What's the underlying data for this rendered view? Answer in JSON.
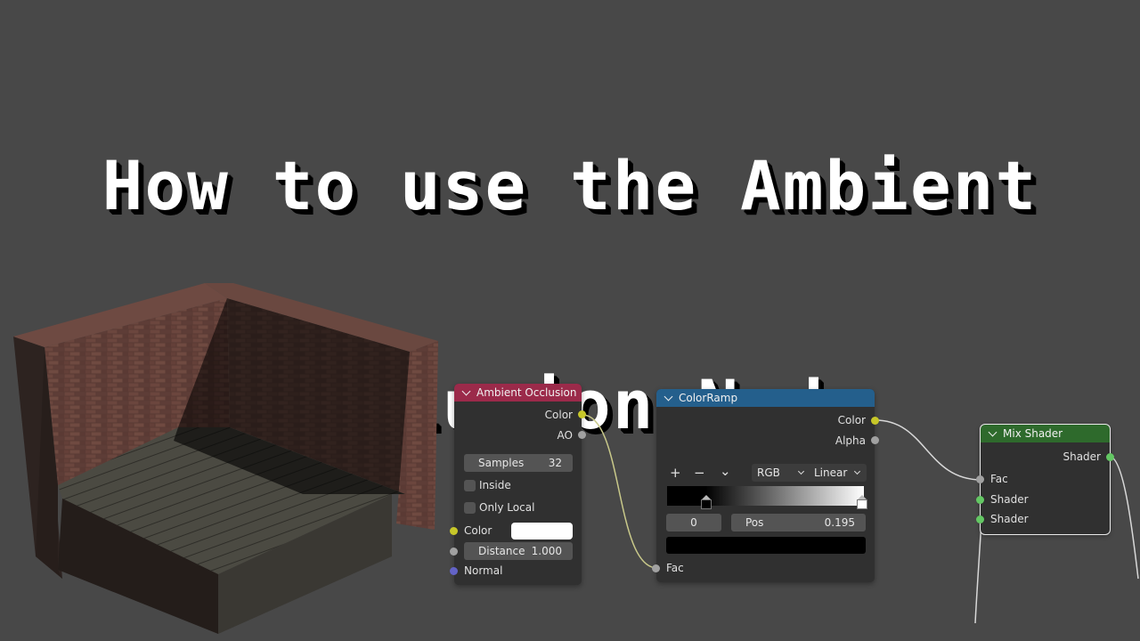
{
  "title": {
    "line1": "How to use the Ambient",
    "line2": "Occlusion Node"
  },
  "colors": {
    "background": "#484848",
    "node_body": "#303030",
    "ao_header": "#9b2a4a",
    "colorramp_header": "#245f8c",
    "mix_header": "#2e6a2c",
    "socket_color": "#c7c729",
    "socket_float": "#a1a1a1",
    "socket_vector": "#6363c7",
    "socket_shader": "#63c763"
  },
  "scene": {
    "description": "3D render of brick walls corner with wooden plank floor"
  },
  "nodes": {
    "ambient_occlusion": {
      "title": "Ambient Occlusion",
      "outputs": [
        "Color",
        "AO"
      ],
      "samples_label": "Samples",
      "samples_value": "32",
      "inside_label": "Inside",
      "inside_checked": false,
      "only_local_label": "Only Local",
      "only_local_checked": false,
      "color_label": "Color",
      "color_value": "#ffffff",
      "distance_label": "Distance",
      "distance_value": "1.000",
      "normal_label": "Normal"
    },
    "color_ramp": {
      "title": "ColorRamp",
      "outputs": [
        "Color",
        "Alpha"
      ],
      "add_label": "+",
      "remove_label": "−",
      "menu_label": "⌄",
      "color_mode": "RGB",
      "interpolation": "Linear",
      "stops": [
        {
          "position": 0.195,
          "color": "#000000"
        },
        {
          "position": 1.0,
          "color": "#ffffff"
        }
      ],
      "active_index": "0",
      "pos_label": "Pos",
      "pos_value": "0.195",
      "active_color": "#000000",
      "input_label": "Fac"
    },
    "mix_shader": {
      "title": "Mix Shader",
      "output": "Shader",
      "inputs": [
        "Fac",
        "Shader",
        "Shader"
      ]
    }
  }
}
